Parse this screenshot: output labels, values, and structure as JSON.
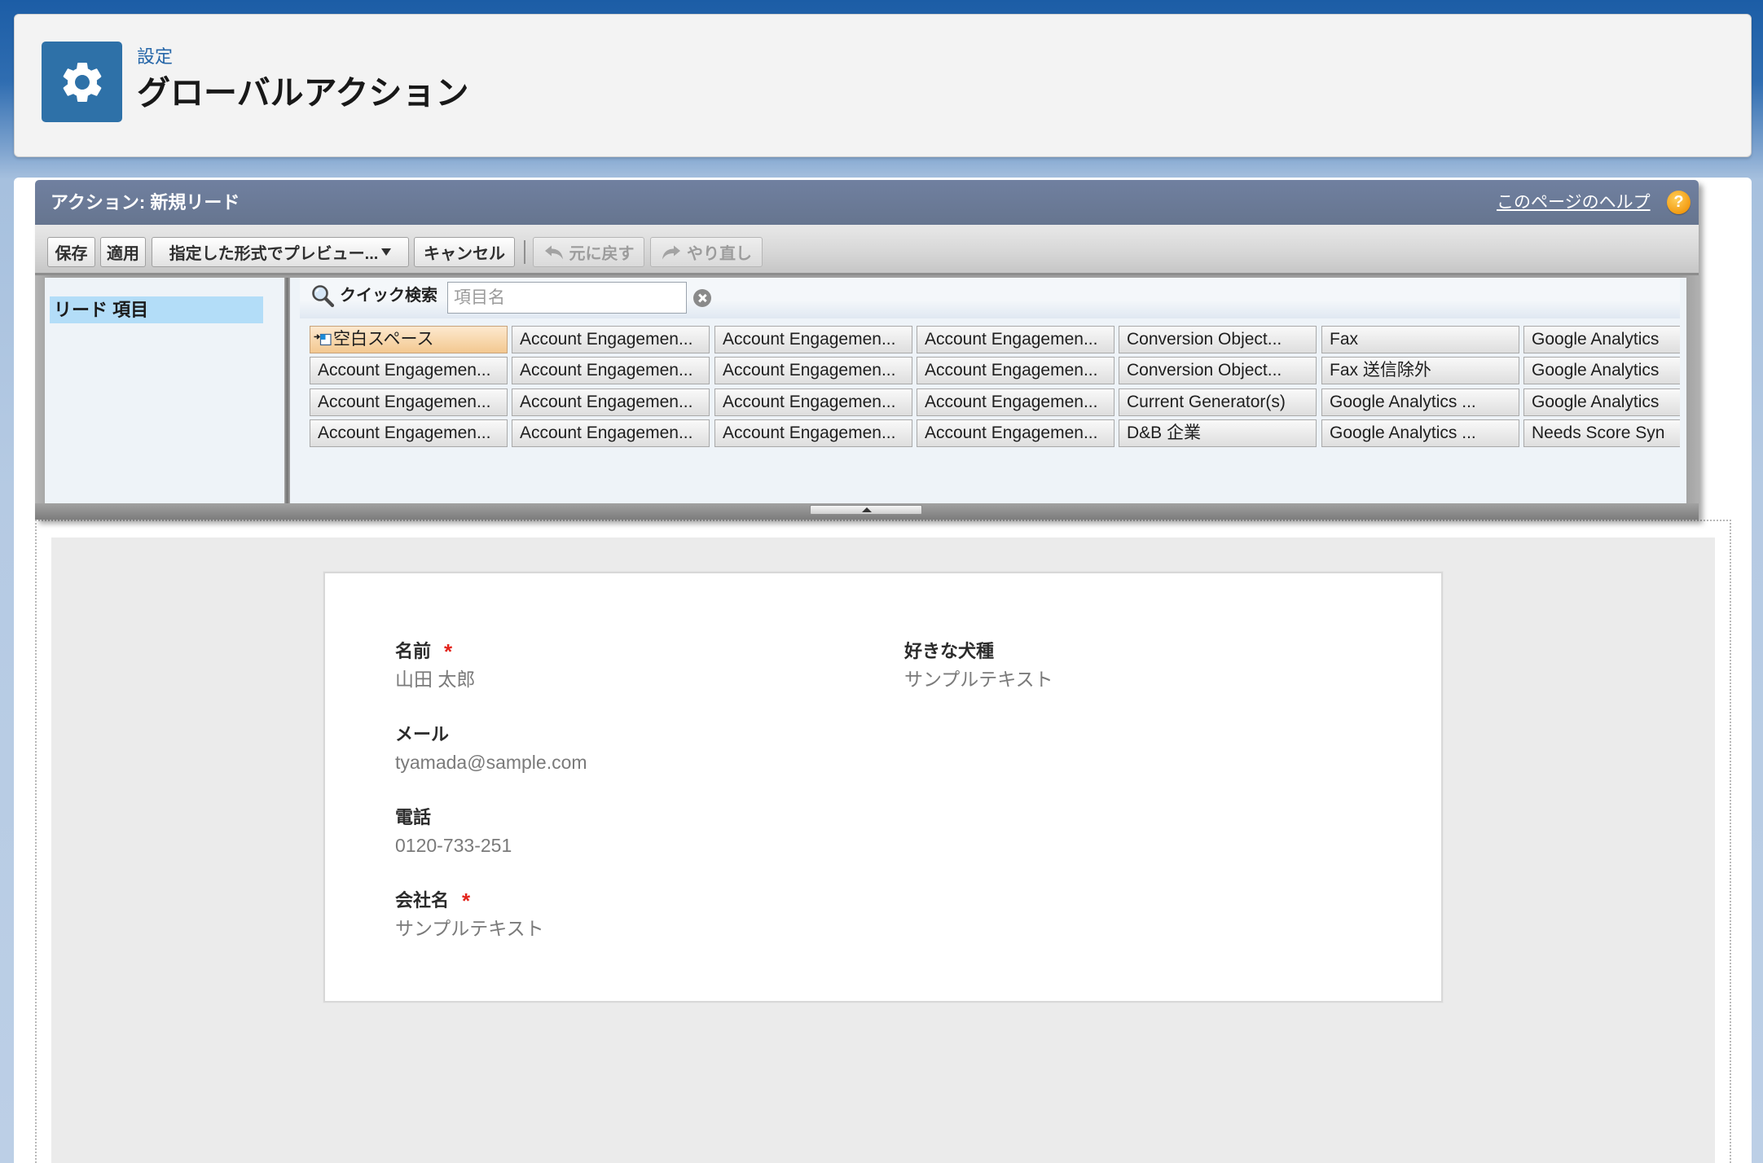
{
  "header": {
    "breadcrumb": "設定",
    "title": "グローバルアクション",
    "icon": "gear-icon"
  },
  "editor": {
    "title": "アクション: 新規リード",
    "help_link": "このページのヘルプ",
    "help_icon": "help-icon",
    "toolbar": {
      "save": "保存",
      "apply": "適用",
      "preview": "指定した形式でプレビュー...",
      "cancel": "キャンセル",
      "undo": "元に戻す",
      "redo": "やり直し",
      "undo_enabled": false,
      "redo_enabled": false
    },
    "sidebar": {
      "items": [
        {
          "label": "リード 項目",
          "selected": true
        }
      ]
    },
    "quick_search": {
      "label": "クイック検索",
      "placeholder": "項目名"
    },
    "palette": {
      "blank_space": "空白スペース",
      "columns": [
        [
          "Account Engagemen...",
          "Account Engagemen...",
          "Account Engagemen..."
        ],
        [
          "Account Engagemen...",
          "Account Engagemen...",
          "Account Engagemen...",
          "Account Engagemen..."
        ],
        [
          "Account Engagemen...",
          "Account Engagemen...",
          "Account Engagemen...",
          "Account Engagemen..."
        ],
        [
          "Account Engagemen...",
          "Account Engagemen...",
          "Account Engagemen...",
          "Account Engagemen..."
        ],
        [
          "Conversion Object...",
          "Conversion Object...",
          "Current Generator(s)",
          "D&B 企業"
        ],
        [
          "Fax",
          "Fax 送信除外",
          "Google Analytics ...",
          "Google Analytics ..."
        ],
        [
          "Google Analytics",
          "Google Analytics",
          "Google Analytics",
          "Needs Score Syn"
        ]
      ]
    }
  },
  "form": {
    "required_marker": "*",
    "left_column": [
      {
        "label": "名前",
        "value": "山田 太郎",
        "required": true
      },
      {
        "label": "メール",
        "value": "tyamada@sample.com",
        "required": false
      },
      {
        "label": "電話",
        "value": "0120-733-251",
        "required": false
      },
      {
        "label": "会社名",
        "value": "サンプルテキスト",
        "required": true
      }
    ],
    "right_column": [
      {
        "label": "好きな犬種",
        "value": "サンプルテキスト",
        "required": false
      }
    ]
  },
  "colors": {
    "title_bar": "#6b7a98",
    "setup_icon_bg": "#2e71a8",
    "link": "#2566a8",
    "selected_item": "#b3ddf8",
    "blank_space": "#f3c890",
    "required": "#e3241b",
    "help_icon": "#f39c12",
    "canvas": "#ebebeb"
  }
}
